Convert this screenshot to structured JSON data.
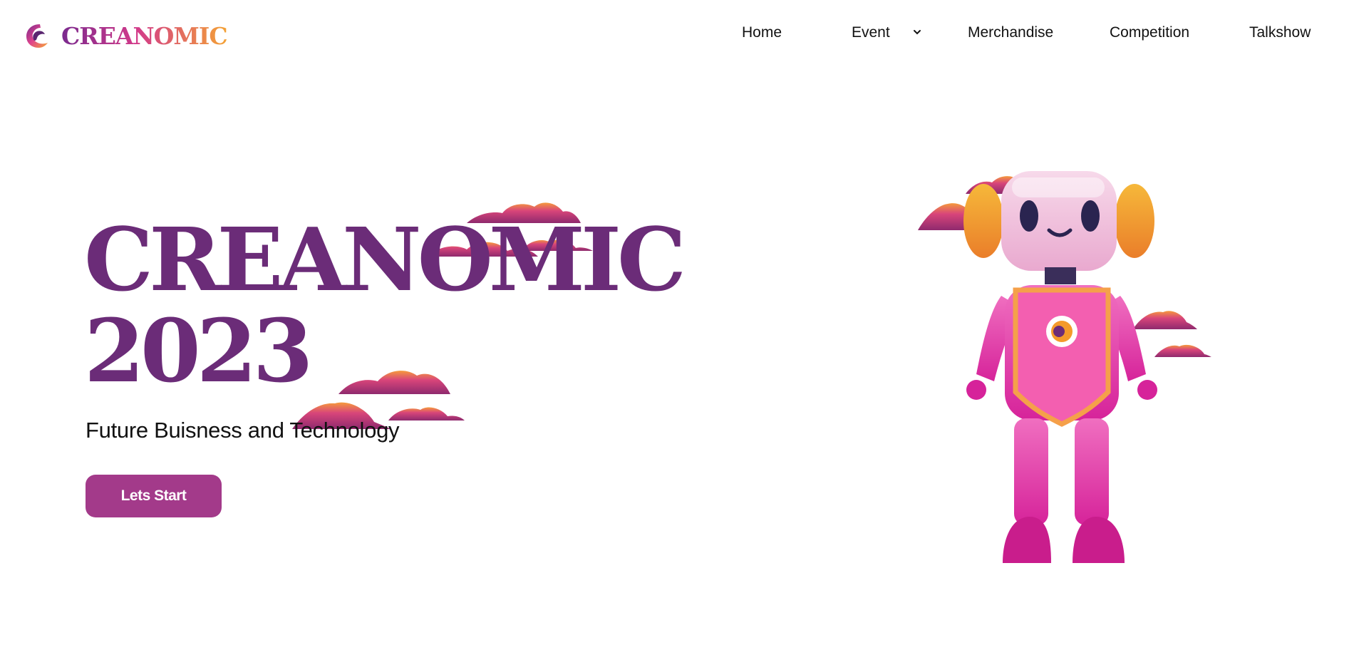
{
  "brand": {
    "name": "CREANOMIC",
    "logo_icon": "creanomic-logo-icon"
  },
  "nav": {
    "items": [
      {
        "label": "Home"
      },
      {
        "label": "Event",
        "has_dropdown": true
      },
      {
        "label": "Merchandise"
      },
      {
        "label": "Competition"
      },
      {
        "label": "Talkshow"
      }
    ],
    "dropdown_icon": "chevron-down-icon"
  },
  "hero": {
    "title_line1": "CREANOMIC",
    "title_line2": "2023",
    "subtitle": "Future Buisness and Technology",
    "cta_label": "Lets Start",
    "illustration": "pink-robot-mascot"
  },
  "colors": {
    "title": "#6b2c78",
    "button": "#a33a8a",
    "robot_pink": "#e64aa8",
    "robot_orange": "#f49a2a",
    "cloud_gradient": [
      "#a0306e",
      "#f08a3a"
    ]
  }
}
